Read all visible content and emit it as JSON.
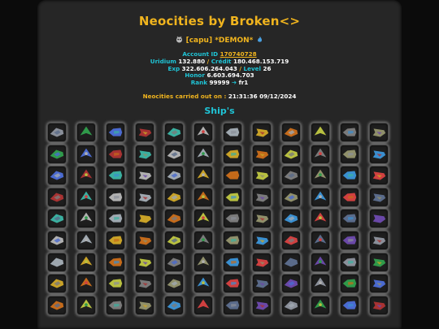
{
  "header": {
    "title": "Neocities by Broken<>"
  },
  "user": {
    "clan": "[capu]",
    "name": "*DEMON*",
    "left_icon": "demon-mask-icon",
    "right_icon": "flame-icon"
  },
  "stats": {
    "account_id_label": "Account ID",
    "account_id": "170740728",
    "uridium_label": "Uridium",
    "uridium": "132.880",
    "credit_label": "Crédit",
    "credit": "180.468.153.719",
    "exp_label": "Exp",
    "exp": "322.606.264.043",
    "level_label": "Level",
    "level": "26",
    "honor_label": "Honor",
    "honor": "6.603.694.703",
    "rank_label": "Rank",
    "rank": "99999",
    "rank_name": "fr1",
    "rank_icon": "arrow-right-icon"
  },
  "carried": {
    "label": "Neocities carried out on :",
    "value": "21:31:36 09/12/2024"
  },
  "ships": {
    "title": "Ship's",
    "palette": [
      "#8a8f99",
      "#c9a227",
      "#5a6b8a",
      "#b0b0b0",
      "#3a8fd0",
      "#a83232",
      "#7a7a7a",
      "#2f9a4a",
      "#c46a1a",
      "#6a48a8",
      "#9fa8b0",
      "#d04040",
      "#3ab0a0",
      "#8f8f6a",
      "#4a6ad0",
      "#b8c040"
    ],
    "count": 108
  }
}
